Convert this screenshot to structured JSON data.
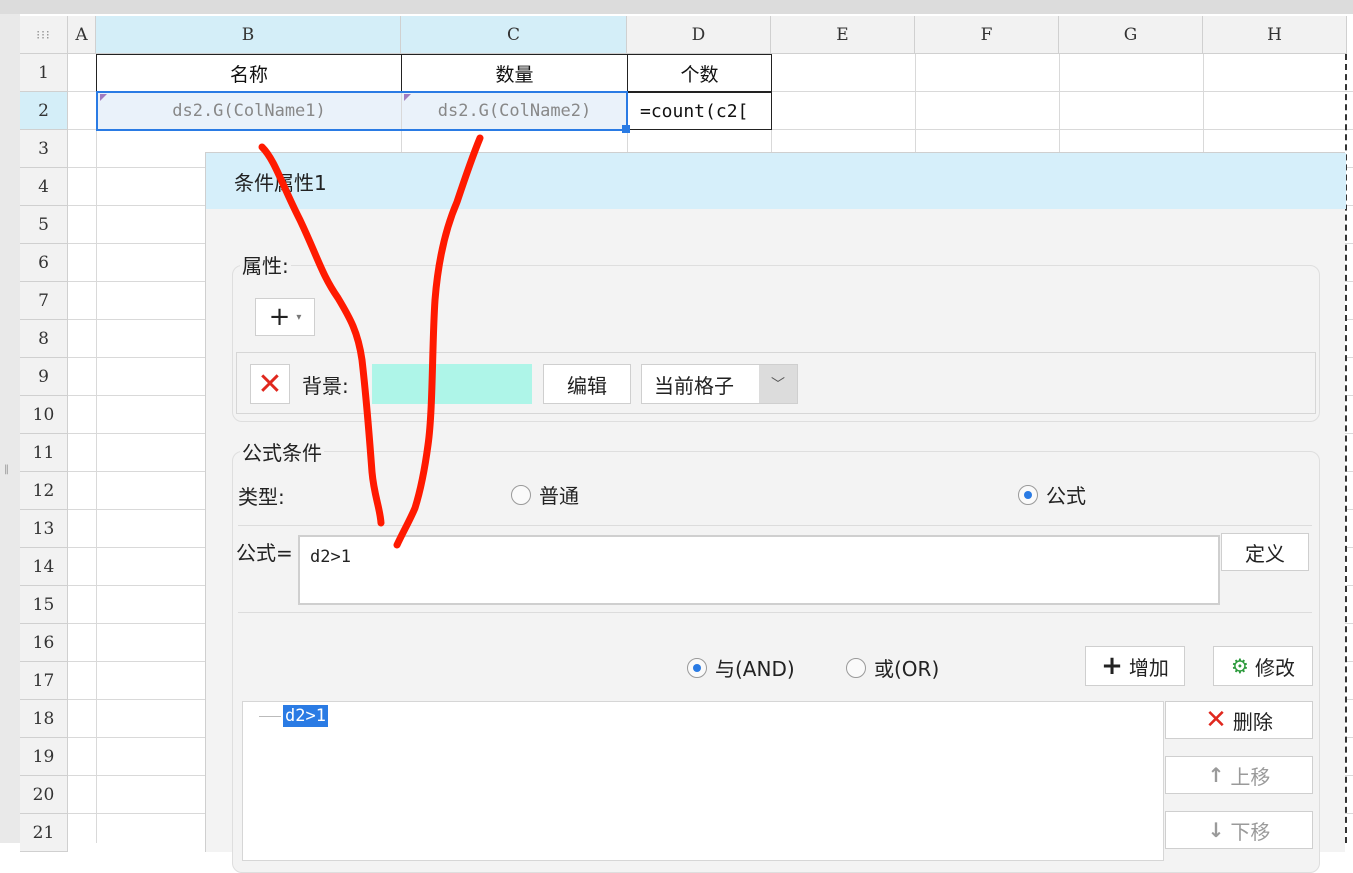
{
  "sheet": {
    "columns": [
      "A",
      "B",
      "C",
      "D",
      "E",
      "F",
      "G",
      "H"
    ],
    "rows": [
      "1",
      "2",
      "3",
      "4",
      "5",
      "6",
      "7",
      "8",
      "9",
      "10",
      "11",
      "12",
      "13",
      "14",
      "15",
      "16",
      "17",
      "18",
      "19",
      "20",
      "21"
    ],
    "header_row": {
      "b1": "名称",
      "c1": "数量",
      "d1": "个数"
    },
    "data_row": {
      "b2": "ds2.G(ColName1)",
      "c2": "ds2.G(ColName2)",
      "d2": "=count(c2["
    },
    "selected_columns": [
      "B",
      "C"
    ],
    "selected_row": "2"
  },
  "dialog": {
    "title": "条件属性1",
    "properties": {
      "legend": "属性:",
      "add_button": "+",
      "background_label": "背景:",
      "background_color": "#aef5e8",
      "edit_button": "编辑",
      "scope_select": "当前格子"
    },
    "formula_condition": {
      "legend": "公式条件",
      "type_label": "类型:",
      "type_normal": "普通",
      "type_formula": "公式",
      "formula_label": "公式=",
      "formula_value": "d2>1",
      "define_button": "定义",
      "and_label": "与(AND)",
      "or_label": "或(OR)",
      "add_button": "增加",
      "modify_button": "修改",
      "conditions": [
        "d2>1"
      ],
      "delete_button": "删除",
      "move_up_button": "上移",
      "move_down_button": "下移"
    }
  },
  "colors": {
    "accent": "#2a7be4",
    "selection_header": "#d4eef8",
    "dialog_title": "#d6effa",
    "annotation": "#ff1a00"
  }
}
